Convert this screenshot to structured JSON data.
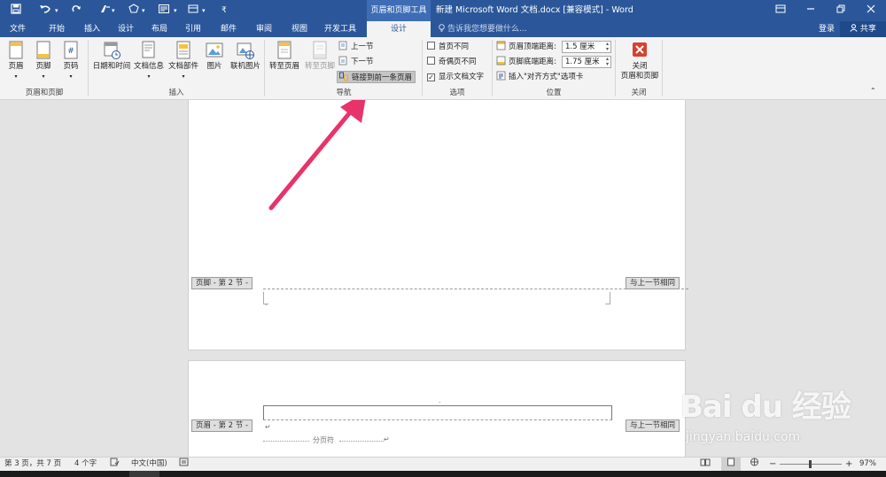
{
  "titlebar": {
    "contextual_title": "页眉和页脚工具",
    "doc_title": "新建 Microsoft Word 文档.docx [兼容模式] - Word",
    "quick_access": [
      "save",
      "undo",
      "redo",
      "format-painter",
      "shape",
      "print-layout",
      "customize"
    ]
  },
  "tabs": {
    "items": [
      "文件",
      "开始",
      "插入",
      "设计",
      "布局",
      "引用",
      "邮件",
      "审阅",
      "视图",
      "开发工具",
      "设计"
    ],
    "active_index": 10,
    "tell_me": "告诉我您想要做什么...",
    "login": "登录",
    "share": "共享"
  },
  "ribbon": {
    "groups": {
      "header_footer": "页眉和页脚",
      "insert": "插入",
      "navigation": "导航",
      "options": "选项",
      "position": "位置",
      "close": "关闭"
    },
    "header_btn": "页眉",
    "footer_btn": "页脚",
    "page_number_btn": "页码",
    "date_time_btn": "日期和时间",
    "doc_info_btn": "文档信息",
    "doc_parts_btn": "文档部件",
    "picture_btn": "图片",
    "online_picture_btn": "联机图片",
    "goto_header_btn": "转至页眉",
    "goto_footer_btn": "转至页脚",
    "prev_section": "上一节",
    "next_section": "下一节",
    "link_to_previous": "链接到前一条页眉",
    "opt_first_page": "首页不同",
    "opt_odd_even": "奇偶页不同",
    "opt_show_text": "显示文档文字",
    "opt_show_text_checked": true,
    "header_top_label": "页眉顶端距离:",
    "header_top_value": "1.5 厘米",
    "footer_bottom_label": "页脚底端距离:",
    "footer_bottom_value": "1.75 厘米",
    "insert_align_tab": "插入\"对齐方式\"选项卡",
    "close_btn_line1": "关闭",
    "close_btn_line2": "页眉和页脚"
  },
  "document": {
    "footer_tag": "页脚 - 第 2 节 -",
    "footer_same": "与上一节相同",
    "header_tag": "页眉 - 第 2 节 -",
    "header_same": "与上一节相同",
    "page_break": "分页符"
  },
  "watermark": {
    "logo": "Bai du 经验",
    "url": "jingyan.baidu.com"
  },
  "statusbar": {
    "page": "第 3 页，共 7 页",
    "words": "4 个字",
    "language": "中文(中国)",
    "zoom_label": "97%",
    "zoom_percent": 97
  },
  "colors": {
    "brand": "#2b579a",
    "arrow": "#e8336a",
    "close_red": "#d9412f"
  }
}
